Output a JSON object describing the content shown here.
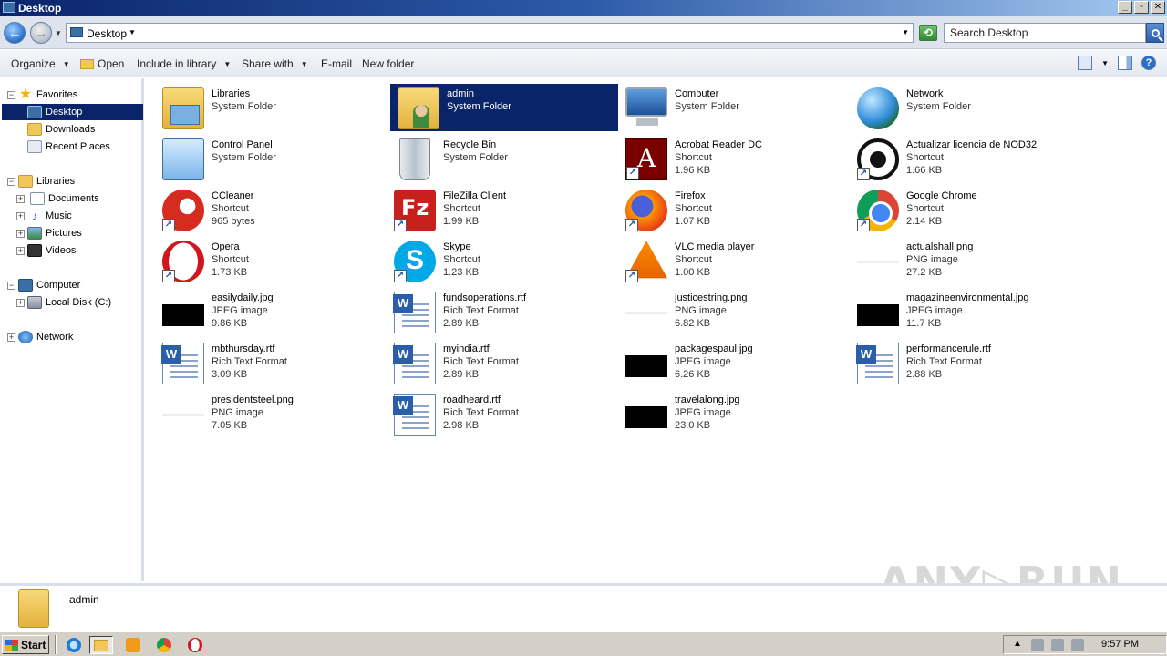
{
  "window": {
    "title": "Desktop",
    "buttons": {
      "minimize": "_",
      "restore": "▫",
      "close": "✕"
    }
  },
  "address": {
    "crumb": "Desktop",
    "search_placeholder": "Search Desktop"
  },
  "commands": {
    "organize": "Organize",
    "open": "Open",
    "include_in_library": "Include in library",
    "share_with": "Share with",
    "email": "E-mail",
    "new_folder": "New folder"
  },
  "nav": {
    "favorites": "Favorites",
    "desktop": "Desktop",
    "downloads": "Downloads",
    "recent_places": "Recent Places",
    "libraries": "Libraries",
    "documents": "Documents",
    "music": "Music",
    "pictures": "Pictures",
    "videos": "Videos",
    "computer": "Computer",
    "local_disk": "Local Disk (C:)",
    "network": "Network"
  },
  "items": [
    {
      "name": "Libraries",
      "type": "System Folder",
      "size": "",
      "icon": "libraries-icon"
    },
    {
      "name": "admin",
      "type": "System Folder",
      "size": "",
      "icon": "user-folder-icon",
      "selected": true
    },
    {
      "name": "Computer",
      "type": "System Folder",
      "size": "",
      "icon": "computer-icon"
    },
    {
      "name": "Network",
      "type": "System Folder",
      "size": "",
      "icon": "network-icon"
    },
    {
      "name": "Control Panel",
      "type": "System Folder",
      "size": "",
      "icon": "control-panel-icon"
    },
    {
      "name": "Recycle Bin",
      "type": "System Folder",
      "size": "",
      "icon": "recycle-bin-icon"
    },
    {
      "name": "Acrobat Reader DC",
      "type": "Shortcut",
      "size": "1.96 KB",
      "icon": "acrobat-icon"
    },
    {
      "name": "Actualizar licencia de NOD32",
      "type": "Shortcut",
      "size": "1.66 KB",
      "icon": "nod32-icon"
    },
    {
      "name": "CCleaner",
      "type": "Shortcut",
      "size": "965 bytes",
      "icon": "ccleaner-icon"
    },
    {
      "name": "FileZilla Client",
      "type": "Shortcut",
      "size": "1.99 KB",
      "icon": "filezilla-icon"
    },
    {
      "name": "Firefox",
      "type": "Shortcut",
      "size": "1.07 KB",
      "icon": "firefox-icon"
    },
    {
      "name": "Google Chrome",
      "type": "Shortcut",
      "size": "2.14 KB",
      "icon": "chrome-icon"
    },
    {
      "name": "Opera",
      "type": "Shortcut",
      "size": "1.73 KB",
      "icon": "opera-icon"
    },
    {
      "name": "Skype",
      "type": "Shortcut",
      "size": "1.23 KB",
      "icon": "skype-icon"
    },
    {
      "name": "VLC media player",
      "type": "Shortcut",
      "size": "1.00 KB",
      "icon": "vlc-icon"
    },
    {
      "name": "actualshall.png",
      "type": "PNG image",
      "size": "27.2 KB",
      "icon": "png-image-icon"
    },
    {
      "name": "easilydaily.jpg",
      "type": "JPEG image",
      "size": "9.86 KB",
      "icon": "jpeg-image-icon"
    },
    {
      "name": "fundsoperations.rtf",
      "type": "Rich Text Format",
      "size": "2.89 KB",
      "icon": "rtf-document-icon"
    },
    {
      "name": "justicestring.png",
      "type": "PNG image",
      "size": "6.82 KB",
      "icon": "png-image-icon"
    },
    {
      "name": "magazineenvironmental.jpg",
      "type": "JPEG image",
      "size": "11.7 KB",
      "icon": "jpeg-image-icon"
    },
    {
      "name": "mbthursday.rtf",
      "type": "Rich Text Format",
      "size": "3.09 KB",
      "icon": "rtf-document-icon"
    },
    {
      "name": "myindia.rtf",
      "type": "Rich Text Format",
      "size": "2.89 KB",
      "icon": "rtf-document-icon"
    },
    {
      "name": "packagespaul.jpg",
      "type": "JPEG image",
      "size": "6.26 KB",
      "icon": "jpeg-image-icon"
    },
    {
      "name": "performancerule.rtf",
      "type": "Rich Text Format",
      "size": "2.88 KB",
      "icon": "rtf-document-icon"
    },
    {
      "name": "presidentsteel.png",
      "type": "PNG image",
      "size": "7.05 KB",
      "icon": "png-image-icon"
    },
    {
      "name": "roadheard.rtf",
      "type": "Rich Text Format",
      "size": "2.98 KB",
      "icon": "rtf-document-icon"
    },
    {
      "name": "travelalong.jpg",
      "type": "JPEG image",
      "size": "23.0 KB",
      "icon": "jpeg-image-icon"
    }
  ],
  "details": {
    "name": "admin"
  },
  "watermark": "ANY▷RUN",
  "taskbar": {
    "start": "Start",
    "clock": "9:57 PM"
  },
  "colors": {
    "selection": "#0a246a",
    "titlebar": "#0a246a"
  }
}
